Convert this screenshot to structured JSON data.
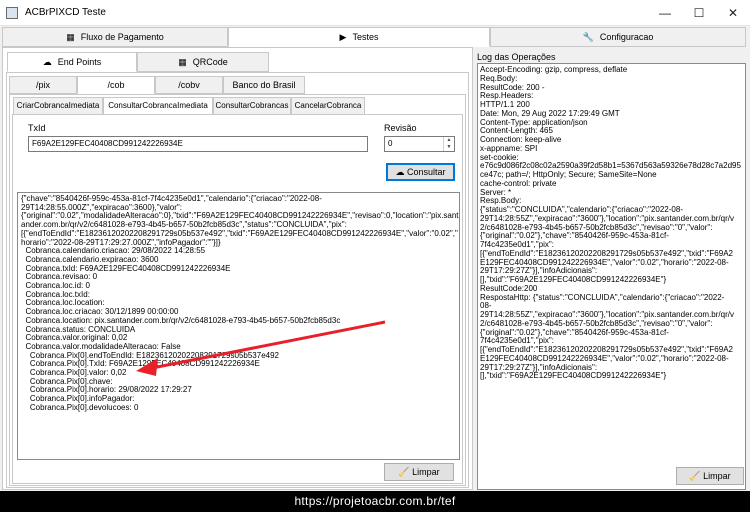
{
  "window": {
    "title": "ACBrPIXCD Teste"
  },
  "main_tabs": [
    {
      "label": "Fluxo de Pagamento",
      "icon": "grid-icon"
    },
    {
      "label": "Testes",
      "icon": "play-icon"
    },
    {
      "label": "Configuracao",
      "icon": "wrench-icon"
    }
  ],
  "section_tabs": [
    {
      "label": "End Points",
      "icon": "cloud-icon"
    },
    {
      "label": "QRCode",
      "icon": "grid-icon"
    }
  ],
  "endpoint_tabs": [
    "/pix",
    "/cob",
    "/cobv",
    "Banco do Brasil"
  ],
  "cob_tabs": [
    "CriarCobrancaImediata",
    "ConsultarCobrancaImediata",
    "ConsultarCobrancas",
    "CancelarCobranca"
  ],
  "form": {
    "txid_label": "TxId",
    "txid_value": "F69A2E129FEC40408CD991242226934E",
    "revisao_label": "Revisão",
    "revisao_value": "0",
    "consultar_label": "Consultar"
  },
  "result_lines": [
    "{\"chave\":\"8540426f-959c-453a-81cf-7f4c4235e0d1\",\"calendario\":{\"criacao\":\"2022-08-",
    "29T14:28:55.000Z\",\"expiracao\":3600},\"valor\":",
    "{\"original\":\"0.02\",\"modalidadeAlteracao\":0},\"txid\":\"F69A2E129FEC40408CD991242226934E\",\"revisao\":0,\"location\":\"pix.sant",
    "ander.com.br/qr/v2/c6481028-e793-4b45-b657-50b2fcb85d3c\",\"status\":\"CONCLUIDA\",\"pix\":",
    "[{\"endToEndId\":\"E18236120202208291729s05b537e492\",\"txid\":\"F69A2E129FEC40408CD991242226934E\",\"valor\":\"0.02\",\"",
    "horario\":\"2022-08-29T17:29:27.000Z\",\"infoPagador\":\"\"}]}",
    "  Cobranca.calendario.criacao: 29/08/2022 14:28:55",
    "  Cobranca.calendario.expiracao: 3600",
    "  Cobranca.txId: F69A2E129FEC40408CD991242226934E",
    "  Cobranca.revisao: 0",
    "  Cobranca.loc.id: 0",
    "  Cobranca.loc.txId:",
    "  Cobranca.loc.location:",
    "  Cobranca.loc.criacao: 30/12/1899 00:00:00",
    "  Cobranca.location: pix.santander.com.br/qr/v2/c6481028-e793-4b45-b657-50b2fcb85d3c",
    "  Cobranca.status: CONCLUIDA",
    "  Cobranca.valor.original: 0,02",
    "  Cobranca.valor.modalidadeAlteracao: False",
    "    Cobranca.Pix[0].endToEndId: E18236120202208291729s05b537e492",
    "    Cobranca.Pix[0].TxId: F69A2E129FEC40408CD991242226934E",
    "    Cobranca.Pix[0].valor: 0,02",
    "    Cobranca.Pix[0].chave:",
    "    Cobranca.Pix[0].horario: 29/08/2022 17:29:27",
    "    Cobranca.Pix[0].infoPagador:",
    "    Cobranca.Pix[0].devolucoes: 0"
  ],
  "limpar_label": "Limpar",
  "log": {
    "title": "Log das Operações",
    "lines": [
      "Accept-Encoding: gzip, compress, deflate",
      "",
      "    Req.Body:",
      "",
      "    ResultCode: 200 -",
      "    Resp.Headers:",
      "HTTP/1.1 200",
      "Date: Mon, 29 Aug 2022 17:29:49 GMT",
      "Content-Type: application/json",
      "Content-Length: 465",
      "Connection: keep-alive",
      "x-appname: SPI",
      "set-cookie:",
      "e76c9d086f2c08c02a2590a39f2d58b1=5367d563a59326e78d28c7a2d95",
      "ce47c; path=/; HttpOnly; Secure; SameSite=None",
      "cache-control: private",
      "Server: *",
      "",
      "",
      "Resp.Body:",
      "{\"status\":\"CONCLUIDA\",\"calendario\":{\"criacao\":\"2022-08-",
      "29T14:28:55Z\",\"expiracao\":\"3600\"},\"location\":\"pix.santander.com.br/qr/v",
      "2/c6481028-e793-4b45-b657-50b2fcb85d3c\",\"revisao\":\"0\",\"valor\":",
      "{\"original\":\"0.02\"},\"chave\":\"8540426f-959c-453a-81cf-",
      "7f4c4235e0d1\",\"pix\":",
      "[{\"endToEndId\":\"E18236120202208291729s05b537e492\",\"txid\":\"F69A2",
      "E129FEC40408CD991242226934E\",\"valor\":\"0.02\",\"horario\":\"2022-08-",
      "29T17:29:27Z\"}],\"infoAdicionais\":",
      "[],\"txid\":\"F69A2E129FEC40408CD991242226934E\"}",
      "    ResultCode:200",
      "    RespostaHttp: {\"status\":\"CONCLUIDA\",\"calendario\":{\"criacao\":\"2022-",
      "08-",
      "29T14:28:55Z\",\"expiracao\":\"3600\"},\"location\":\"pix.santander.com.br/qr/v",
      "2/c6481028-e793-4b45-b657-50b2fcb85d3c\",\"revisao\":\"0\",\"valor\":",
      "{\"original\":\"0.02\"},\"chave\":\"8540426f-959c-453a-81cf-",
      "7f4c4235e0d1\",\"pix\":",
      "[{\"endToEndId\":\"E18236120202208291729s05b537e492\",\"txid\":\"F69A2",
      "E129FEC40408CD991242226934E\",\"valor\":\"0.02\",\"horario\":\"2022-08-",
      "29T17:29:27Z\"}],\"infoAdicionais\":",
      "[],\"txid\":\"F69A2E129FEC40408CD991242226934E\"}"
    ],
    "limpar_label": "Limpar"
  },
  "status_bar": {
    "url": "https://projetoacbr.com.br/tef"
  },
  "colors": {
    "annotation_arrow": "#e8202a",
    "focus_border": "#0078d7"
  }
}
